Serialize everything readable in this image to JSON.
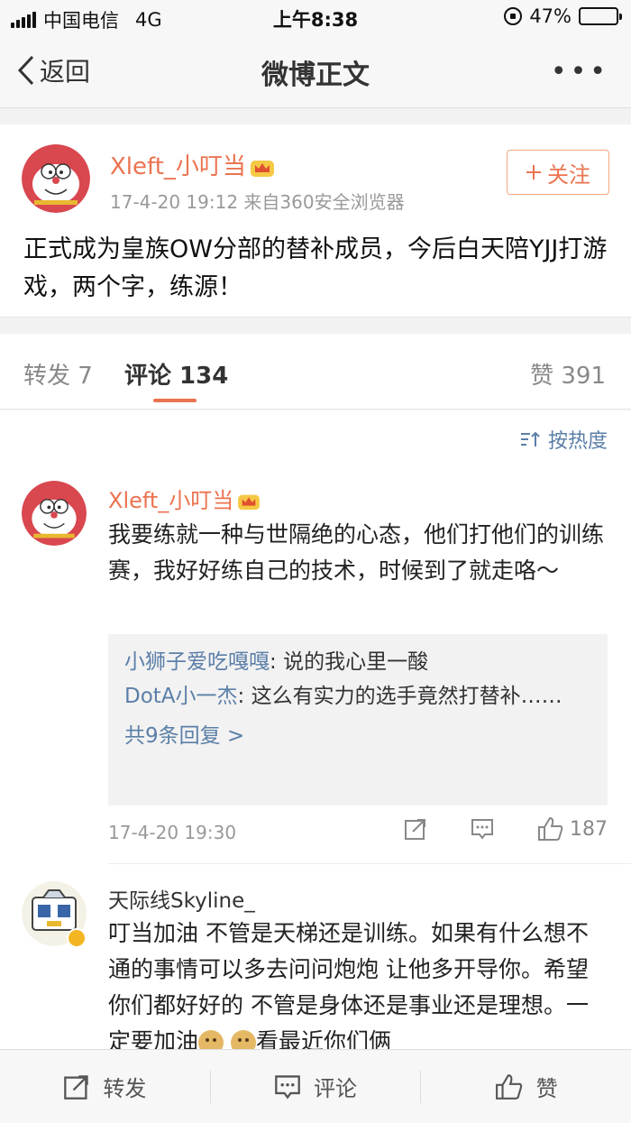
{
  "status": {
    "carrier": "中国电信",
    "network": "4G",
    "time": "上午8:38",
    "battery": "47%",
    "battery_level": 0.47
  },
  "nav": {
    "back_label": "返回",
    "title": "微博正文",
    "more_label": "•••"
  },
  "post": {
    "author": "Xleft_小叮当",
    "meta": "17-4-20 19:12  来自360安全浏览器",
    "follow_label": "关注",
    "text": "正式成为皇族OW分部的替补成员，今后白天陪YJJ打游戏，两个字，练源！"
  },
  "tabs": {
    "repost": "转发 7",
    "comment": "评论 134",
    "like": "赞 391"
  },
  "sort_label": "按热度",
  "comment1": {
    "author": "Xleft_小叮当",
    "text": "我要练就一种与世隔绝的心态，他们打他们的训练赛，我好好练自己的技术，时候到了就走咯～",
    "replies": [
      {
        "name": "小狮子爱吃嘎嘎",
        "text": "说的我心里一酸"
      },
      {
        "name": "DotA小一杰",
        "text": "这么有实力的选手竟然打替补……"
      }
    ],
    "more_replies": "共9条回复 >",
    "time": "17-4-20 19:30",
    "likes": "187"
  },
  "comment2": {
    "author": "天际线Skyline_",
    "text_a": "叮当加油  不管是天梯还是训练。如果有什么想不通的事情可以多去问问炮炮  让他多开导你。希望你们都好好的  不管是身体还是事业还是理想。一定要加油",
    "text_b": "看最近你们俩"
  },
  "bottom": {
    "repost": "转发",
    "comment": "评论",
    "like": "赞"
  },
  "colors": {
    "accent": "#eb7350",
    "link": "#5b7fa8"
  }
}
